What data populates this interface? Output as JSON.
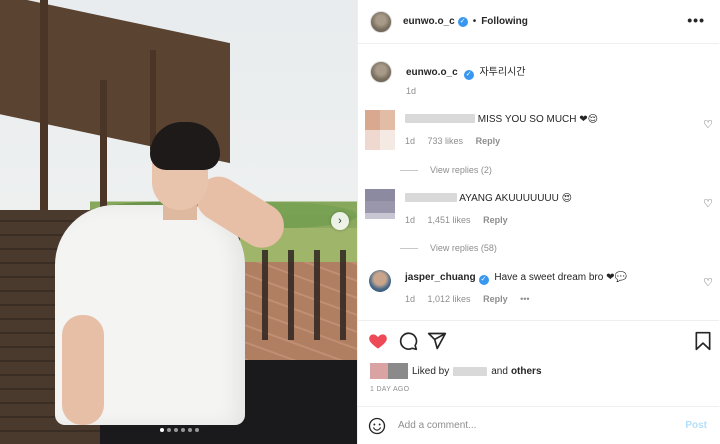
{
  "post": {
    "username": "eunwo.o_c",
    "follow_status": "Following",
    "more_label": "•••",
    "caption_text": "자투리시간",
    "caption_time": "1d",
    "next_arrow": "›",
    "carousel": {
      "total": 6,
      "active_index": 0
    }
  },
  "comments": [
    {
      "text": "MISS YOU SO MUCH",
      "emoji": "❤😌",
      "time": "1d",
      "likes": "733 likes",
      "reply_label": "Reply",
      "view_replies": "View replies (2)"
    },
    {
      "text": "AYANG AKUUUUUUU",
      "emoji": "😍",
      "time": "1d",
      "likes": "1,451 likes",
      "reply_label": "Reply",
      "view_replies": "View replies (58)"
    },
    {
      "username": "jasper_chuang",
      "text": "Have a sweet dream bro",
      "emoji": "❤💬",
      "time": "1d",
      "likes": "1,012 likes",
      "reply_label": "Reply",
      "more": "•••"
    }
  ],
  "actions": {
    "liked_by_prefix": "Liked by",
    "liked_by_suffix": "and",
    "others": "others",
    "time_ago": "1 DAY AGO"
  },
  "add_comment": {
    "placeholder": "Add a comment...",
    "post_label": "Post"
  },
  "colors": {
    "heart_red": "#ed4956",
    "verified_blue": "#3897f0",
    "post_disabled": "#b2dffc"
  }
}
